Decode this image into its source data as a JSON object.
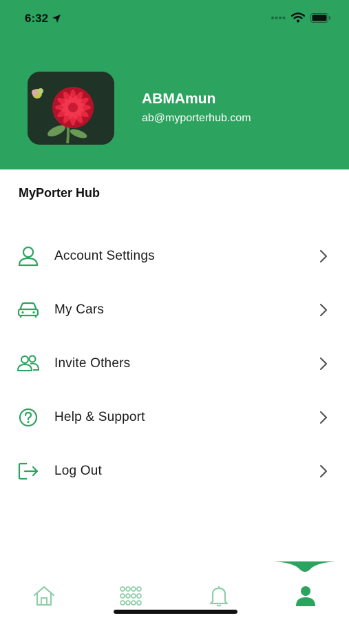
{
  "status_bar": {
    "time": "6:32"
  },
  "profile": {
    "name": "ABMAmun",
    "email": "ab@myporterhub.com"
  },
  "section": {
    "title": "MyPorter Hub"
  },
  "menu": {
    "items": [
      {
        "label": "Account Settings",
        "icon": "user-icon"
      },
      {
        "label": "My Cars",
        "icon": "car-icon"
      },
      {
        "label": "Invite Others",
        "icon": "users-icon"
      },
      {
        "label": "Help & Support",
        "icon": "help-circle-icon"
      },
      {
        "label": "Log Out",
        "icon": "logout-icon"
      }
    ]
  },
  "tab_bar": {
    "tabs": [
      {
        "icon": "home-icon"
      },
      {
        "icon": "grid-icon"
      },
      {
        "icon": "bell-icon"
      },
      {
        "icon": "profile-icon",
        "active": true
      }
    ]
  },
  "colors": {
    "brand_green": "#2ca35f",
    "icon_green": "#2ca35f",
    "inactive_tab": "#8fcfaa"
  }
}
